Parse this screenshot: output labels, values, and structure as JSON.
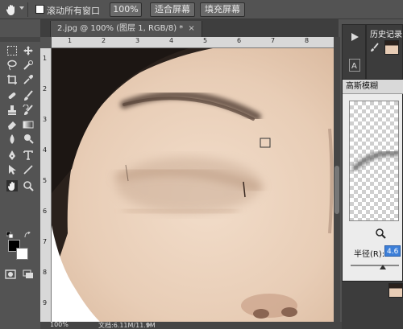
{
  "options_bar": {
    "scroll_all_windows_label": "滚动所有窗口",
    "zoom_100_label": "100%",
    "fit_screen_label": "适合屏幕",
    "fill_screen_label": "填充屏幕"
  },
  "document_tab": {
    "title": "2.jpg @ 100% (图层 1, RGB/8) *",
    "close_glyph": "×"
  },
  "history_panel": {
    "title": "历史记录"
  },
  "gaussian_blur_dialog": {
    "title": "高斯模糊",
    "radius_label": "半径(R):",
    "radius_value": "4.6"
  },
  "status_bar": {
    "zoom": "100%",
    "doc_info": "文档:6.11M/11.9M"
  },
  "rulers": {
    "h_ticks": [
      "1",
      "2",
      "3",
      "4",
      "5",
      "6",
      "7",
      "8"
    ],
    "v_ticks": [
      "1",
      "2",
      "3",
      "4",
      "5",
      "6",
      "7",
      "8",
      "9"
    ]
  },
  "colors": {
    "panel_bg": "#535353",
    "canvas_skin": "#e9d3c0",
    "dialog_bg": "#ececec",
    "radius_highlight": "#3d7fd8"
  }
}
